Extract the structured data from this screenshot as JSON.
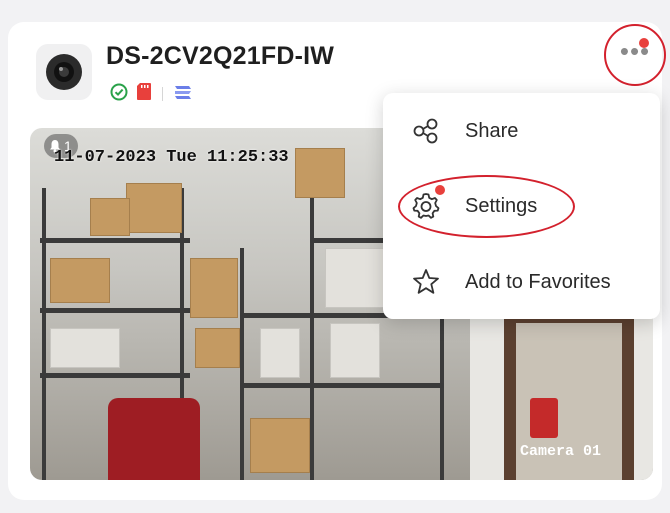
{
  "device": {
    "name": "DS-2CV2Q21FD-IW",
    "icon": "camera-icon",
    "status_icons": [
      "online-check-icon",
      "sd-card-icon",
      "storage-icon"
    ]
  },
  "more_button": {
    "icon": "more-dots-icon",
    "has_notification": true
  },
  "video": {
    "timestamp": "11-07-2023 Tue 11:25:33",
    "camera_label": "Camera 01",
    "badge_count": "1"
  },
  "menu": {
    "items": [
      {
        "label": "Share",
        "icon": "share-icon"
      },
      {
        "label": "Settings",
        "icon": "gear-icon",
        "has_notification": true
      },
      {
        "label": "Add to Favorites",
        "icon": "star-icon"
      }
    ]
  },
  "colors": {
    "accent_red": "#d3212d",
    "notification_dot": "#e8403c",
    "online_green": "#2aa24a",
    "sd_red": "#e8403c",
    "storage_blue": "#6b7ee8"
  }
}
